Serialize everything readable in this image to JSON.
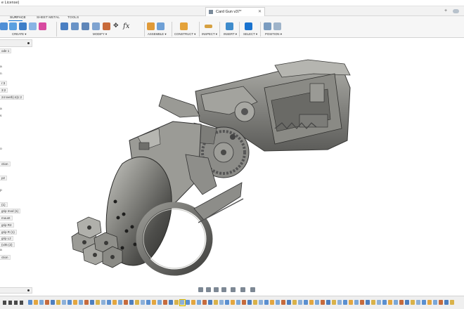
{
  "window": {
    "license_text": "e License)",
    "document_tab": "Card Gun v37*",
    "close_glyph": "✕",
    "new_tab_glyph": "+"
  },
  "toolbar": {
    "workspace_tabs": [
      "SURFACE",
      "SHEET METAL",
      "TOOLS"
    ],
    "groups": {
      "create": "CREATE ▾",
      "modify": "MODIFY ▾",
      "assemble": "ASSEMBLE ▾",
      "construct": "CONSTRUCT ▾",
      "inspect": "INSPECT ▾",
      "insert": "INSERT ▾",
      "select": "SELECT ▾",
      "position": "POSITION ▾"
    },
    "fx_glyph": "fx"
  },
  "browser": {
    "rows": [
      "ode 1",
      "r:3",
      "3:2",
      "24 teeth):4|1:2",
      "ction",
      "p2",
      "(1)",
      "grip mod (1)",
      "mount",
      "grip R2",
      "grip R (1)",
      "grip L2",
      "(v35 (2)",
      "ction"
    ],
    "mini_labels": [
      "a",
      "n",
      "a",
      "s",
      "o",
      "p",
      "a"
    ]
  },
  "colors": {
    "accent_blue": "#0a6fd1",
    "toolbar_bg": "#f6f6f6",
    "part_metal": "#8a8a84",
    "timeline_highlight": "#fff3a0"
  },
  "icons": {
    "navbar": [
      "orbit-icon",
      "pan-icon",
      "zoom-icon",
      "fit-icon",
      "display-settings-icon",
      "grid-icon",
      "viewports-icon"
    ]
  }
}
